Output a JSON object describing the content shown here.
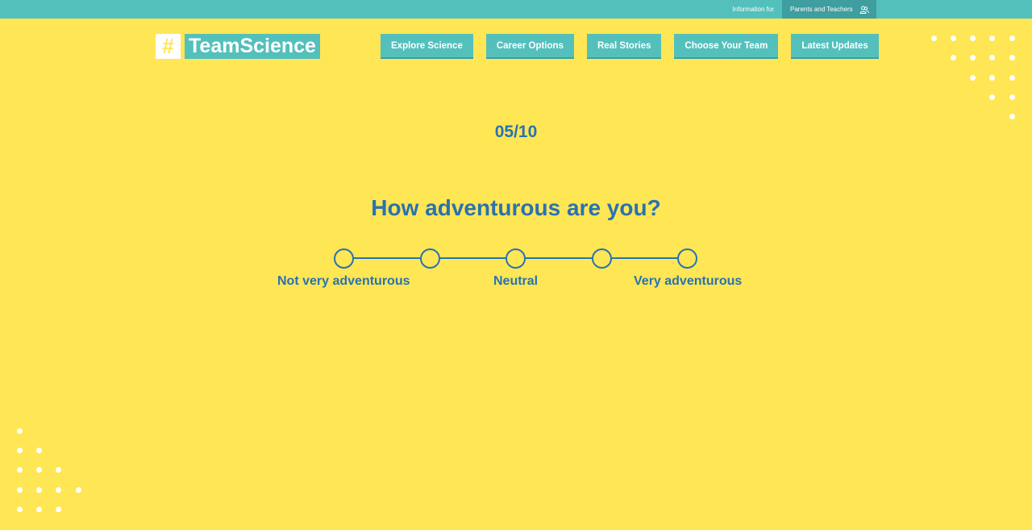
{
  "topbar": {
    "info_label": "Information for",
    "parents_teachers_label": "Parents and Teachers"
  },
  "logo": {
    "hash": "#",
    "name": "TeamScience"
  },
  "nav": {
    "items": [
      {
        "label": "Explore Science"
      },
      {
        "label": "Career Options"
      },
      {
        "label": "Real Stories"
      },
      {
        "label": "Choose Your Team"
      },
      {
        "label": "Latest Updates"
      }
    ]
  },
  "quiz": {
    "counter": "05/10",
    "question": "How adventurous are you?",
    "scale_count": 5,
    "labels": {
      "low": "Not very adventurous",
      "mid": "Neutral",
      "high": "Very adventurous"
    }
  },
  "colors": {
    "background": "#ffe654",
    "teal": "#53c0bc",
    "teal_dark": "#3f9e9f",
    "blue_text": "#2a72b0"
  },
  "icons": {
    "users": "users-icon"
  }
}
